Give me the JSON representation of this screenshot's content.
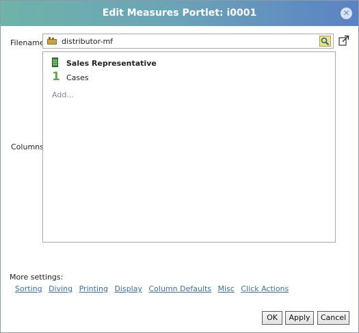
{
  "dialog": {
    "title": "Edit Measures Portlet: i0001",
    "close_icon": "✕"
  },
  "filename": {
    "label": "Filename:",
    "value": "distributor-mf"
  },
  "columns": {
    "label": "Columns:",
    "items": [
      {
        "label": "Sales Representative",
        "icon": "dimension-icon"
      },
      {
        "label": "Cases",
        "icon": "measure-number-icon",
        "icon_glyph": "1"
      }
    ],
    "add_label": "Add..."
  },
  "more_settings": {
    "label": "More settings:",
    "links": [
      "Sorting",
      "Diving",
      "Printing",
      "Display",
      "Column Defaults",
      "Misc",
      "Click Actions"
    ]
  },
  "buttons": {
    "ok": "OK",
    "apply": "Apply",
    "cancel": "Cancel"
  },
  "colors": {
    "title_gradient_start": "#6fb3a9",
    "title_gradient_end": "#5b82c4",
    "link": "#3a6fb0",
    "measure_icon": "#5aa84f",
    "dimension_icon": "#3d8a3d"
  }
}
